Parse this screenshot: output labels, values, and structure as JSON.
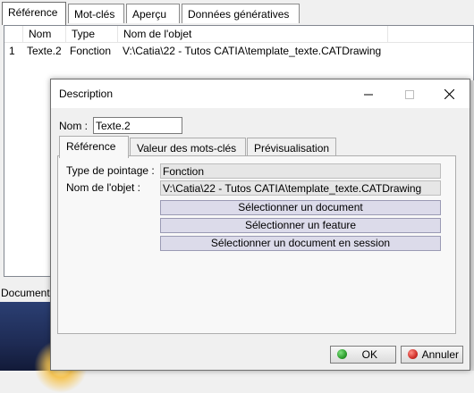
{
  "top_tabs": [
    "Référence",
    "Mot-clés",
    "Aperçu",
    "Données génératives"
  ],
  "list": {
    "columns": [
      "Nom",
      "Type",
      "Nom de l'objet"
    ],
    "rows": [
      {
        "index": "1",
        "name": "Texte.2",
        "type": "Fonction",
        "object": "V:\\Catia\\22 - Tutos CATIA\\template_texte.CATDrawing"
      }
    ]
  },
  "status_strip": "Document",
  "dialog": {
    "title": "Description",
    "name_label": "Nom :",
    "name_value": "Texte.2",
    "tabs": [
      "Référence",
      "Valeur des mots-clés",
      "Prévisualisation"
    ],
    "pointing_type_label": "Type de pointage :",
    "pointing_type_value": "Fonction",
    "object_name_label": "Nom de l'objet :",
    "object_name_value": "V:\\Catia\\22 - Tutos CATIA\\template_texte.CATDrawing",
    "buttons": [
      "Sélectionner un document",
      "Sélectionner un feature",
      "Sélectionner un document en session"
    ],
    "ok_label": "OK",
    "cancel_label": "Annuler",
    "ok_color": "#2e9e2e",
    "cancel_color": "#d0302a"
  },
  "icons": {
    "minimize": "minimize-icon",
    "maximize": "maximize-icon",
    "close": "close-icon"
  }
}
